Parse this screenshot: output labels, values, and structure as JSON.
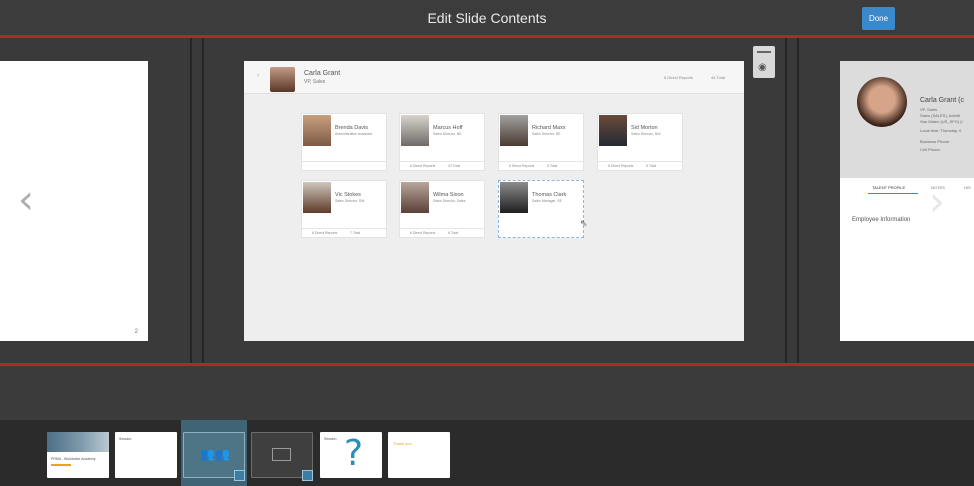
{
  "header": {
    "title": "Edit Slide Contents",
    "done_label": "Done"
  },
  "left_slide": {
    "page_number": "2"
  },
  "center_slide": {
    "manager_name": "Carla Grant",
    "manager_role": "VP, Sales",
    "direct_reports_label": "6 Direct Reports",
    "total_label": "44 Total",
    "cards": [
      {
        "name": "Brenda Davis",
        "role": "Administrative Assistant",
        "direct": "",
        "total": ""
      },
      {
        "name": "Marcus Hoff",
        "role": "Sales Director, NE",
        "direct": "6 Direct Reports",
        "total": "22 Total"
      },
      {
        "name": "Richard Maxx",
        "role": "Sales Director, SE",
        "direct": "6 Direct Reports",
        "total": "5 Total"
      },
      {
        "name": "Sid Morton",
        "role": "Sales Director, NW",
        "direct": "6 Direct Reports",
        "total": "5 Total"
      },
      {
        "name": "Vic Stokes",
        "role": "Sales Director, SW",
        "direct": "6 Direct Reports",
        "total": "7 Total"
      },
      {
        "name": "Wilma Sixon",
        "role": "Sales Director, Sales",
        "direct": "6 Direct Reports",
        "total": "6 Total"
      },
      {
        "name": "Thomas Clark",
        "role": "Sales Manager, SE",
        "direct": "",
        "total": ""
      }
    ]
  },
  "right_slide": {
    "name": "Carla Grant (c",
    "lines": [
      "VP, Sales",
      "Sales (SALES), Activiti",
      "San Mateo (US_SFO) (i",
      "Local time: Thursday, 0",
      "Business Phone:",
      "Cell Phone:"
    ],
    "tabs": [
      "TALENT PROFILE",
      "NOTES",
      "HIS"
    ],
    "employee_info": "Employee Information"
  },
  "thumbnails": [
    {
      "title": "PRMA - Worldwide Academy"
    },
    {
      "title": "Session"
    },
    {
      "title": ""
    },
    {
      "title": ""
    },
    {
      "title": "Session"
    },
    {
      "title": "Thank you"
    }
  ],
  "colors": {
    "accent": "#3b88cb",
    "red_guide": "#b3272d",
    "selected_thumb_bg": "#3e6476"
  }
}
